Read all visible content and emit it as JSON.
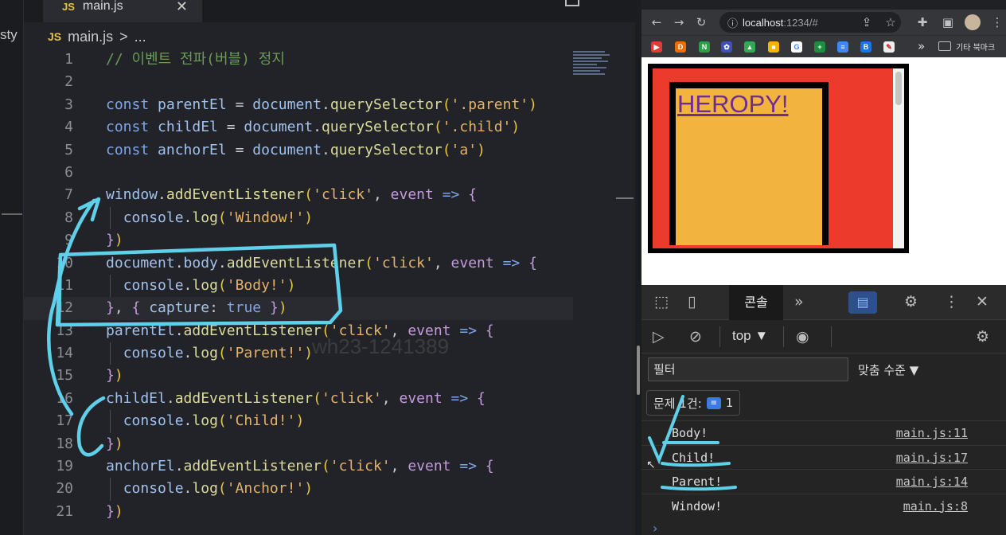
{
  "editor": {
    "sidebar_label": "sty",
    "tab": {
      "badge": "JS",
      "name": "main.js",
      "close": "✕"
    },
    "breadcrumb": {
      "badge": "JS",
      "file": "main.js",
      "sep": ">",
      "rest": "..."
    },
    "watermark": "wh23-1241389",
    "lines": [
      {
        "n": "1",
        "html": "<span class='cm'>// 이벤트 전파(버블) 정지</span>"
      },
      {
        "n": "2",
        "html": ""
      },
      {
        "n": "3",
        "html": "<span class='kw'>const</span> <span class='var'>parentEl</span> <span class='op'>=</span> <span class='var'>document</span><span class='op'>.</span><span class='fn'>querySelector</span><span class='par'>(</span><span class='str'>'.parent'</span><span class='par'>)</span>"
      },
      {
        "n": "4",
        "html": "<span class='kw'>const</span> <span class='var'>childEl</span> <span class='op'>=</span> <span class='var'>document</span><span class='op'>.</span><span class='fn'>querySelector</span><span class='par'>(</span><span class='str'>'.child'</span><span class='par'>)</span>"
      },
      {
        "n": "5",
        "html": "<span class='kw'>const</span> <span class='var'>anchorEl</span> <span class='op'>=</span> <span class='var'>document</span><span class='op'>.</span><span class='fn'>querySelector</span><span class='par'>(</span><span class='str'>'a'</span><span class='par'>)</span>"
      },
      {
        "n": "6",
        "html": ""
      },
      {
        "n": "7",
        "html": "<span class='var'>window</span><span class='op'>.</span><span class='fn'>addEventListener</span><span class='par'>(</span><span class='str'>'click'</span><span class='op'>,</span> <span class='prm'>event</span> <span class='kw'>=&gt;</span> <span class='prm'>{</span>"
      },
      {
        "n": "8",
        "html": "  <span class='var'>console</span><span class='op'>.</span><span class='fn'>log</span><span class='par'>(</span><span class='str'>'Window!'</span><span class='par'>)</span>",
        "guide": true
      },
      {
        "n": "9",
        "html": "<span class='prm'>}</span><span class='par'>)</span>"
      },
      {
        "n": "10",
        "html": "<span class='var'>document</span><span class='op'>.</span><span class='var'>body</span><span class='op'>.</span><span class='fn'>addEventListener</span><span class='par'>(</span><span class='str'>'click'</span><span class='op'>,</span> <span class='prm'>event</span> <span class='kw'>=&gt;</span> <span class='prm'>{</span>"
      },
      {
        "n": "11",
        "html": "  <span class='var'>console</span><span class='op'>.</span><span class='fn'>log</span><span class='par'>(</span><span class='str'>'Body!'</span><span class='par'>)</span>",
        "guide": true
      },
      {
        "n": "12",
        "html": "<span class='prm'>}</span><span class='op'>,</span> <span class='prm'>{</span> <span class='prop'>capture</span><span class='op'>:</span> <span class='bool'>true</span> <span class='prm'>}</span><span class='par'>)</span>",
        "active": true
      },
      {
        "n": "13",
        "html": "<span class='var'>parentEl</span><span class='op'>.</span><span class='fn'>addEventListener</span><span class='par'>(</span><span class='str'>'click'</span><span class='op'>,</span> <span class='prm'>event</span> <span class='kw'>=&gt;</span> <span class='prm'>{</span>"
      },
      {
        "n": "14",
        "html": "  <span class='var'>console</span><span class='op'>.</span><span class='fn'>log</span><span class='par'>(</span><span class='str'>'Parent!'</span><span class='par'>)</span>",
        "guide": true
      },
      {
        "n": "15",
        "html": "<span class='prm'>}</span><span class='par'>)</span>"
      },
      {
        "n": "16",
        "html": "<span class='var'>childEl</span><span class='op'>.</span><span class='fn'>addEventListener</span><span class='par'>(</span><span class='str'>'click'</span><span class='op'>,</span> <span class='prm'>event</span> <span class='kw'>=&gt;</span> <span class='prm'>{</span>"
      },
      {
        "n": "17",
        "html": "  <span class='var'>console</span><span class='op'>.</span><span class='fn'>log</span><span class='par'>(</span><span class='str'>'Child!'</span><span class='par'>)</span>",
        "guide": true
      },
      {
        "n": "18",
        "html": "<span class='prm'>}</span><span class='par'>)</span>"
      },
      {
        "n": "19",
        "html": "<span class='var'>anchorEl</span><span class='op'>.</span><span class='fn'>addEventListener</span><span class='par'>(</span><span class='str'>'click'</span><span class='op'>,</span> <span class='prm'>event</span> <span class='kw'>=&gt;</span> <span class='prm'>{</span>"
      },
      {
        "n": "20",
        "html": "  <span class='var'>console</span><span class='op'>.</span><span class='fn'>log</span><span class='par'>(</span><span class='str'>'Anchor!'</span><span class='par'>)</span>",
        "guide": true
      },
      {
        "n": "21",
        "html": "<span class='prm'>}</span><span class='par'>)</span>"
      }
    ]
  },
  "browser": {
    "url_host": "localhost",
    "url_rest": ":1234/#",
    "bookmarks_folder": "기타 북마크",
    "anchor_text": "HEROPY!"
  },
  "devtools": {
    "console_tab": "콘솔",
    "more_tabs": "»",
    "context": "top ▼",
    "filter_placeholder": "필터",
    "level": "맞춤 수준 ▼",
    "issues_label": "문제 1건:",
    "issues_count": "1",
    "logs": [
      {
        "msg": "Body!",
        "src": "main.js:11"
      },
      {
        "msg": "Child!",
        "src": "main.js:17"
      },
      {
        "msg": "Parent!",
        "src": "main.js:14"
      },
      {
        "msg": "Window!",
        "src": "main.js:8"
      }
    ],
    "prompt": "›"
  },
  "colors": {
    "annotation": "#5fd0ea",
    "parent_bg": "#ec3a2d",
    "child_bg": "#f2b33f",
    "anchor": "#6f2d8f"
  }
}
